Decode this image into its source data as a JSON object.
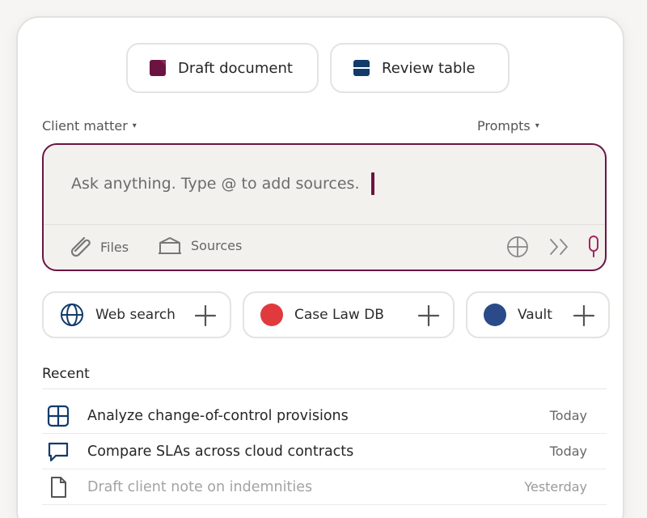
{
  "actions": {
    "draft_label": "Draft document",
    "review_label": "Review table"
  },
  "selectors": {
    "client_matter": "Client matter",
    "prompts": "Prompts",
    "caret": "▾"
  },
  "composer": {
    "placeholder": "Ask anything. Type @ to add sources.",
    "files_label": "Files",
    "sources_label": "Sources",
    "more_label": "〉〉"
  },
  "chips": [
    {
      "label": "Web search",
      "icon": "globe-icon"
    },
    {
      "label": "Case Law DB",
      "icon": "red-dot-icon",
      "color": "#e03a3e"
    },
    {
      "label": "Vault",
      "icon": "blue-dot-icon",
      "color": "#2a4a8a"
    }
  ],
  "recent": {
    "title": "Recent",
    "items": [
      {
        "title": "Analyze change-of-control provisions",
        "date": "Today",
        "icon": "table-grid-icon"
      },
      {
        "title": "Compare SLAs across cloud contracts",
        "date": "Today",
        "icon": "chat-bubble-icon"
      },
      {
        "title": "Draft client note on indemnities",
        "date": "Yesterday",
        "icon": "document-icon"
      }
    ]
  },
  "colors": {
    "accent": "#6b1442",
    "navy": "#123a6b",
    "case_law_red": "#e03a3e",
    "vault_blue": "#2a4a8a"
  }
}
